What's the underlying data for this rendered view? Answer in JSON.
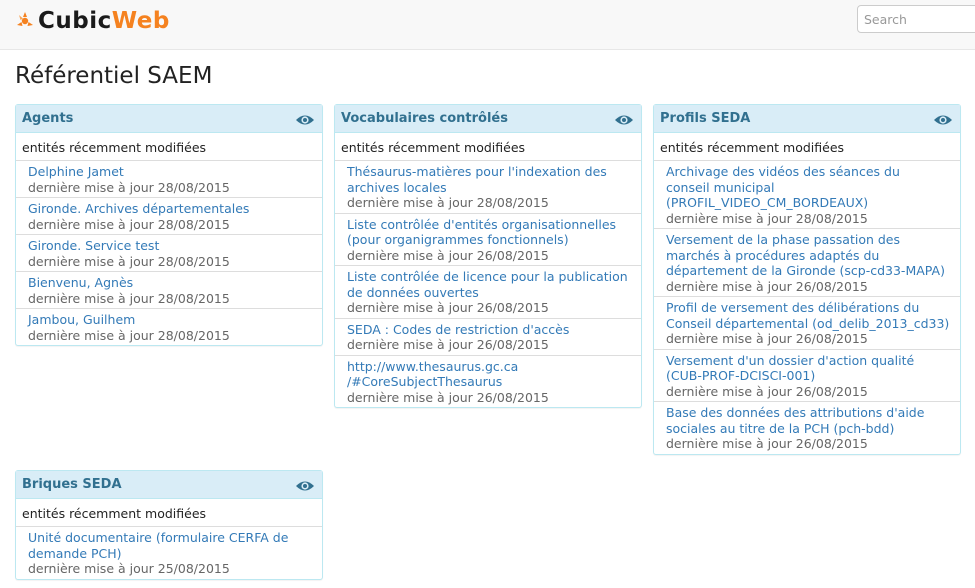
{
  "header": {
    "logo_text_cubic": "Cubic",
    "logo_text_web": "Web",
    "search_placeholder": "Search"
  },
  "page": {
    "title": "Référentiel SAEM"
  },
  "colors": {
    "accent": "#f58220",
    "link": "#337ab7",
    "panel_head": "#d9edf7",
    "panel_title": "#31708f"
  },
  "panels": [
    {
      "title": "Agents",
      "subtitle": "entités récemment modifiées",
      "items": [
        {
          "lines": [
            "Delphine Jamet"
          ],
          "date": "dernière mise à jour 28/08/2015"
        },
        {
          "lines": [
            "Gironde. Archives départementales"
          ],
          "date": "dernière mise à jour 28/08/2015"
        },
        {
          "lines": [
            "Gironde. Service test"
          ],
          "date": "dernière mise à jour 28/08/2015"
        },
        {
          "lines": [
            "Bienvenu, Agnès"
          ],
          "date": "dernière mise à jour 28/08/2015"
        },
        {
          "lines": [
            "Jambou, Guilhem"
          ],
          "date": "dernière mise à jour 28/08/2015"
        }
      ]
    },
    {
      "title": "Vocabulaires contrôlés",
      "subtitle": "entités récemment modifiées",
      "items": [
        {
          "lines": [
            "Thésaurus-matières pour l'indexation des",
            "archives locales"
          ],
          "date": "dernière mise à jour 28/08/2015"
        },
        {
          "lines": [
            "Liste contrôlée d'entités organisationnelles",
            "(pour organigrammes fonctionnels)"
          ],
          "date": "dernière mise à jour 26/08/2015"
        },
        {
          "lines": [
            "Liste contrôlée de licence pour la publication",
            "de données ouvertes"
          ],
          "date": "dernière mise à jour 26/08/2015"
        },
        {
          "lines": [
            "SEDA : Codes de restriction d'accès"
          ],
          "date": "dernière mise à jour 26/08/2015"
        },
        {
          "lines": [
            "http://www.thesaurus.gc.ca",
            "/#CoreSubjectThesaurus"
          ],
          "date": "dernière mise à jour 26/08/2015"
        }
      ]
    },
    {
      "title": "Profils SEDA",
      "subtitle": "entités récemment modifiées",
      "items": [
        {
          "lines": [
            "Archivage des vidéos des séances du",
            "conseil municipal",
            "(PROFIL_VIDEO_CM_BORDEAUX)"
          ],
          "date": "dernière mise à jour 28/08/2015"
        },
        {
          "lines": [
            "Versement de la phase passation des",
            "marchés à procédures adaptés du",
            "département de la Gironde (scp-cd33-MAPA)"
          ],
          "date": "dernière mise à jour 26/08/2015"
        },
        {
          "lines": [
            "Profil de versement des délibérations du",
            "Conseil départemental (od_delib_2013_cd33)"
          ],
          "date": "dernière mise à jour 26/08/2015"
        },
        {
          "lines": [
            "Versement d'un dossier d'action qualité",
            "(CUB-PROF-DCISCI-001)"
          ],
          "date": "dernière mise à jour 26/08/2015"
        },
        {
          "lines": [
            "Base des données des attributions d'aide",
            "sociales au titre de la PCH (pch-bdd)"
          ],
          "date": "dernière mise à jour 26/08/2015"
        }
      ]
    },
    {
      "title": "Briques SEDA",
      "subtitle": "entités récemment modifiées",
      "items": [
        {
          "lines": [
            "Unité documentaire (formulaire CERFA de",
            "demande PCH)"
          ],
          "date": "dernière mise à jour 25/08/2015"
        }
      ]
    }
  ]
}
